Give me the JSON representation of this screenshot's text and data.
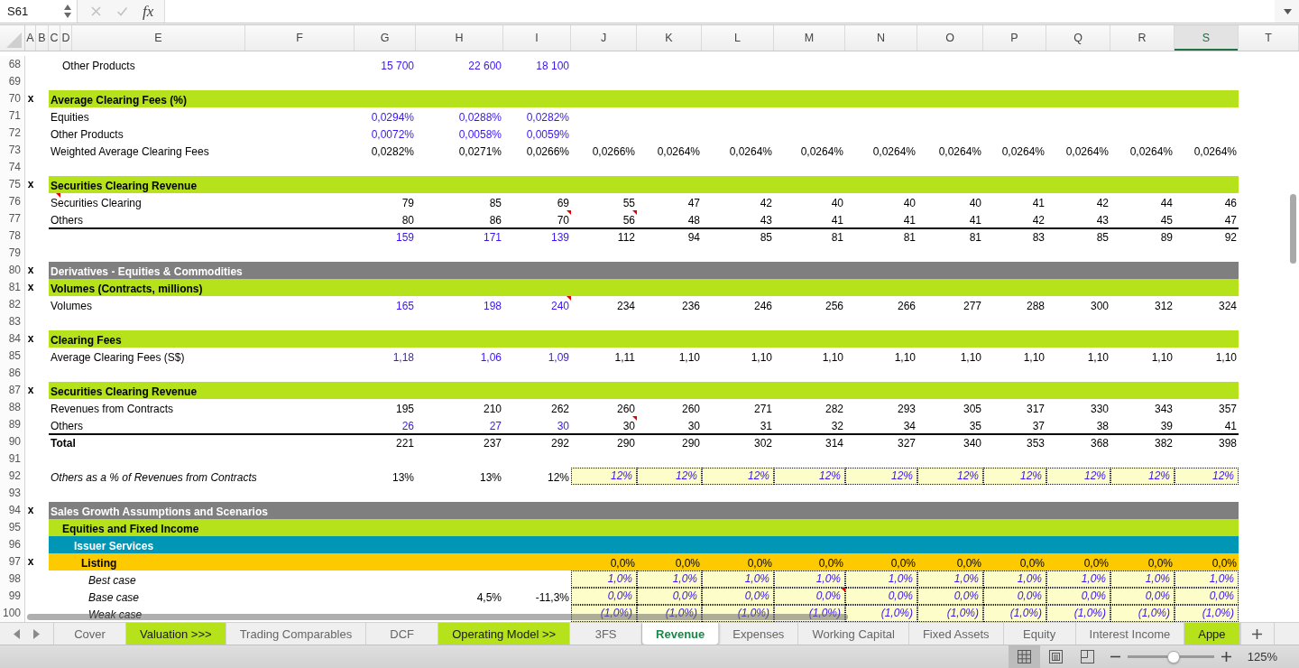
{
  "formula_bar": {
    "name_box": "S61",
    "buttons": [
      {
        "kind": "cancel",
        "disabled": true
      },
      {
        "kind": "confirm",
        "disabled": true
      }
    ],
    "function_label": "fx"
  },
  "columns": [
    {
      "label": "A",
      "selected": false
    },
    {
      "label": "B",
      "selected": false
    },
    {
      "label": "C",
      "selected": false
    },
    {
      "label": "D",
      "selected": false
    },
    {
      "label": "E",
      "selected": false
    },
    {
      "label": "F",
      "selected": false
    },
    {
      "label": "G",
      "selected": false
    },
    {
      "label": "H",
      "selected": false
    },
    {
      "label": "I",
      "selected": false
    },
    {
      "label": "J",
      "selected": false
    },
    {
      "label": "K",
      "selected": false
    },
    {
      "label": "L",
      "selected": false
    },
    {
      "label": "M",
      "selected": false
    },
    {
      "label": "N",
      "selected": false
    },
    {
      "label": "O",
      "selected": false
    },
    {
      "label": "P",
      "selected": false
    },
    {
      "label": "Q",
      "selected": false
    },
    {
      "label": "R",
      "selected": false
    },
    {
      "label": "S",
      "selected": true
    },
    {
      "label": "T",
      "selected": false
    }
  ],
  "rows": [
    {
      "number": "68",
      "kind": "data",
      "cells": [
        null,
        {
          "text": "Other Products",
          "kind": "label",
          "bold": false,
          "italic": false,
          "comment": false
        },
        null,
        null,
        {
          "text": "15 700",
          "kind": "input",
          "comment": false
        },
        {
          "text": "22 600",
          "kind": "input",
          "comment": false
        },
        {
          "text": "18 100",
          "kind": "input",
          "comment": false
        }
      ]
    },
    {
      "number": "69",
      "kind": "blank"
    },
    {
      "number": "70",
      "flag": "x",
      "kind": "band",
      "color": "#b5e21a",
      "cells": [
        {
          "text": "Average Clearing Fees (%)",
          "kind": "label",
          "bold": true,
          "italic": false,
          "comment": false
        }
      ]
    },
    {
      "number": "71",
      "kind": "data",
      "cells": [
        {
          "text": "Equities",
          "kind": "label",
          "bold": false,
          "italic": false,
          "comment": false
        },
        null,
        null,
        null,
        {
          "text": "0,0294%",
          "kind": "input",
          "comment": false
        },
        {
          "text": "0,0288%",
          "kind": "input",
          "comment": false
        },
        {
          "text": "0,0282%",
          "kind": "input",
          "comment": false
        }
      ]
    },
    {
      "number": "72",
      "kind": "data",
      "cells": [
        {
          "text": "Other Products",
          "kind": "label",
          "bold": false,
          "italic": false,
          "comment": false
        },
        null,
        null,
        null,
        {
          "text": "0,0072%",
          "kind": "input",
          "comment": false
        },
        {
          "text": "0,0058%",
          "kind": "input",
          "comment": false
        },
        {
          "text": "0,0059%",
          "kind": "input",
          "comment": false
        }
      ]
    },
    {
      "number": "73",
      "kind": "data",
      "cells": [
        {
          "text": "Weighted Average Clearing Fees",
          "kind": "label",
          "bold": false,
          "italic": false,
          "comment": false
        },
        null,
        null,
        null,
        {
          "text": "0,0282%",
          "kind": "formula",
          "comment": false
        },
        {
          "text": "0,0271%",
          "kind": "formula",
          "comment": false
        },
        {
          "text": "0,0266%",
          "kind": "formula",
          "comment": false
        },
        {
          "text": "0,0266%",
          "kind": "formula",
          "comment": false
        },
        {
          "text": "0,0264%",
          "kind": "formula",
          "comment": false
        },
        {
          "text": "0,0264%",
          "kind": "formula",
          "comment": false
        },
        {
          "text": "0,0264%",
          "kind": "formula",
          "comment": false
        },
        {
          "text": "0,0264%",
          "kind": "formula",
          "comment": false
        },
        {
          "text": "0,0264%",
          "kind": "formula",
          "comment": false
        },
        {
          "text": "0,0264%",
          "kind": "formula",
          "comment": false
        },
        {
          "text": "0,0264%",
          "kind": "formula",
          "comment": false
        },
        {
          "text": "0,0264%",
          "kind": "formula",
          "comment": false
        },
        {
          "text": "0,0264%",
          "kind": "formula",
          "comment": false
        }
      ]
    },
    {
      "number": "74",
      "kind": "blank"
    },
    {
      "number": "75",
      "flag": "x",
      "kind": "band",
      "color": "#b5e21a",
      "cells": [
        {
          "text": "Securities Clearing Revenue",
          "kind": "label",
          "bold": true,
          "italic": false,
          "comment": false
        }
      ]
    },
    {
      "number": "76",
      "kind": "data",
      "cells": [
        {
          "text": "Securities Clearing",
          "kind": "label",
          "bold": false,
          "italic": false,
          "comment": true
        },
        null,
        null,
        null,
        {
          "text": "79",
          "kind": "formula",
          "comment": false
        },
        {
          "text": "85",
          "kind": "formula",
          "comment": false
        },
        {
          "text": "69",
          "kind": "formula",
          "comment": false
        },
        {
          "text": "55",
          "kind": "formula",
          "comment": false
        },
        {
          "text": "47",
          "kind": "formula",
          "comment": false
        },
        {
          "text": "42",
          "kind": "formula",
          "comment": false
        },
        {
          "text": "40",
          "kind": "formula",
          "comment": false
        },
        {
          "text": "40",
          "kind": "formula",
          "comment": false
        },
        {
          "text": "40",
          "kind": "formula",
          "comment": false
        },
        {
          "text": "41",
          "kind": "formula",
          "comment": false
        },
        {
          "text": "42",
          "kind": "formula",
          "comment": false
        },
        {
          "text": "44",
          "kind": "formula",
          "comment": false
        },
        {
          "text": "46",
          "kind": "formula",
          "comment": false
        }
      ]
    },
    {
      "number": "77",
      "kind": "data",
      "cells": [
        {
          "text": "Others",
          "kind": "label",
          "bold": false,
          "italic": false,
          "comment": false
        },
        null,
        null,
        null,
        {
          "text": "80",
          "kind": "formula",
          "comment": false
        },
        {
          "text": "86",
          "kind": "formula",
          "comment": false
        },
        {
          "text": "70",
          "kind": "formula",
          "comment": true
        },
        {
          "text": "56",
          "kind": "formula",
          "comment": true
        },
        {
          "text": "48",
          "kind": "formula",
          "comment": false
        },
        {
          "text": "43",
          "kind": "formula",
          "comment": false
        },
        {
          "text": "41",
          "kind": "formula",
          "comment": false
        },
        {
          "text": "41",
          "kind": "formula",
          "comment": false
        },
        {
          "text": "41",
          "kind": "formula",
          "comment": false
        },
        {
          "text": "42",
          "kind": "formula",
          "comment": false
        },
        {
          "text": "43",
          "kind": "formula",
          "comment": false
        },
        {
          "text": "45",
          "kind": "formula",
          "comment": false
        },
        {
          "text": "47",
          "kind": "formula",
          "comment": false
        }
      ]
    },
    {
      "number": "78",
      "kind": "total",
      "cells": [
        null,
        null,
        null,
        null,
        {
          "text": "159",
          "kind": "input",
          "comment": false
        },
        {
          "text": "171",
          "kind": "input",
          "comment": false
        },
        {
          "text": "139",
          "kind": "input",
          "comment": false
        },
        {
          "text": "112",
          "kind": "formula",
          "comment": false
        },
        {
          "text": "94",
          "kind": "formula",
          "comment": false
        },
        {
          "text": "85",
          "kind": "formula",
          "comment": false
        },
        {
          "text": "81",
          "kind": "formula",
          "comment": false
        },
        {
          "text": "81",
          "kind": "formula",
          "comment": false
        },
        {
          "text": "81",
          "kind": "formula",
          "comment": false
        },
        {
          "text": "83",
          "kind": "formula",
          "comment": false
        },
        {
          "text": "85",
          "kind": "formula",
          "comment": false
        },
        {
          "text": "89",
          "kind": "formula",
          "comment": false
        },
        {
          "text": "92",
          "kind": "formula",
          "comment": false
        }
      ]
    },
    {
      "number": "79",
      "kind": "blank"
    },
    {
      "number": "80",
      "flag": "x",
      "kind": "band",
      "color": "#7f7f7f",
      "cells": [
        {
          "text": "Derivatives - Equities & Commodities",
          "kind": "label",
          "bold": true,
          "italic": false,
          "comment": false
        }
      ]
    },
    {
      "number": "81",
      "flag": "x",
      "kind": "band",
      "color": "#b5e21a",
      "cells": [
        {
          "text": "Volumes (Contracts, millions)",
          "kind": "label",
          "bold": true,
          "italic": false,
          "comment": false
        }
      ]
    },
    {
      "number": "82",
      "kind": "data",
      "cells": [
        {
          "text": "Volumes",
          "kind": "label",
          "bold": false,
          "italic": false,
          "comment": false
        },
        null,
        null,
        null,
        {
          "text": "165",
          "kind": "input",
          "comment": false
        },
        {
          "text": "198",
          "kind": "input",
          "comment": false
        },
        {
          "text": "240",
          "kind": "input",
          "comment": true
        },
        {
          "text": "234",
          "kind": "formula",
          "comment": false
        },
        {
          "text": "236",
          "kind": "formula",
          "comment": false
        },
        {
          "text": "246",
          "kind": "formula",
          "comment": false
        },
        {
          "text": "256",
          "kind": "formula",
          "comment": false
        },
        {
          "text": "266",
          "kind": "formula",
          "comment": false
        },
        {
          "text": "277",
          "kind": "formula",
          "comment": false
        },
        {
          "text": "288",
          "kind": "formula",
          "comment": false
        },
        {
          "text": "300",
          "kind": "formula",
          "comment": false
        },
        {
          "text": "312",
          "kind": "formula",
          "comment": false
        },
        {
          "text": "324",
          "kind": "formula",
          "comment": false
        }
      ]
    },
    {
      "number": "83",
      "kind": "blank"
    },
    {
      "number": "84",
      "flag": "x",
      "kind": "band",
      "color": "#b5e21a",
      "cells": [
        {
          "text": "Clearing Fees",
          "kind": "label",
          "bold": true,
          "italic": false,
          "comment": false
        }
      ]
    },
    {
      "number": "85",
      "kind": "data",
      "cells": [
        {
          "text": "Average Clearing Fees (S$)",
          "kind": "label",
          "bold": false,
          "italic": false,
          "comment": false
        },
        null,
        null,
        null,
        {
          "text": "1,18",
          "kind": "input",
          "comment": false
        },
        {
          "text": "1,06",
          "kind": "input",
          "comment": false
        },
        {
          "text": "1,09",
          "kind": "input",
          "comment": false
        },
        {
          "text": "1,11",
          "kind": "formula",
          "comment": false
        },
        {
          "text": "1,10",
          "kind": "formula",
          "comment": false
        },
        {
          "text": "1,10",
          "kind": "formula",
          "comment": false
        },
        {
          "text": "1,10",
          "kind": "formula",
          "comment": false
        },
        {
          "text": "1,10",
          "kind": "formula",
          "comment": false
        },
        {
          "text": "1,10",
          "kind": "formula",
          "comment": false
        },
        {
          "text": "1,10",
          "kind": "formula",
          "comment": false
        },
        {
          "text": "1,10",
          "kind": "formula",
          "comment": false
        },
        {
          "text": "1,10",
          "kind": "formula",
          "comment": false
        },
        {
          "text": "1,10",
          "kind": "formula",
          "comment": false
        }
      ]
    },
    {
      "number": "86",
      "kind": "blank"
    },
    {
      "number": "87",
      "flag": "x",
      "kind": "band",
      "color": "#b5e21a",
      "cells": [
        {
          "text": "Securities Clearing Revenue",
          "kind": "label",
          "bold": true,
          "italic": false,
          "comment": false
        }
      ]
    },
    {
      "number": "88",
      "kind": "data",
      "cells": [
        {
          "text": "Revenues from Contracts",
          "kind": "label",
          "bold": false,
          "italic": false,
          "comment": false
        },
        null,
        null,
        null,
        {
          "text": "195",
          "kind": "formula",
          "comment": false
        },
        {
          "text": "210",
          "kind": "formula",
          "comment": false
        },
        {
          "text": "262",
          "kind": "formula",
          "comment": false
        },
        {
          "text": "260",
          "kind": "formula",
          "comment": false
        },
        {
          "text": "260",
          "kind": "formula",
          "comment": false
        },
        {
          "text": "271",
          "kind": "formula",
          "comment": false
        },
        {
          "text": "282",
          "kind": "formula",
          "comment": false
        },
        {
          "text": "293",
          "kind": "formula",
          "comment": false
        },
        {
          "text": "305",
          "kind": "formula",
          "comment": false
        },
        {
          "text": "317",
          "kind": "formula",
          "comment": false
        },
        {
          "text": "330",
          "kind": "formula",
          "comment": false
        },
        {
          "text": "343",
          "kind": "formula",
          "comment": false
        },
        {
          "text": "357",
          "kind": "formula",
          "comment": false
        }
      ]
    },
    {
      "number": "89",
      "kind": "data",
      "cells": [
        {
          "text": "Others",
          "kind": "label",
          "bold": false,
          "italic": false,
          "comment": false
        },
        null,
        null,
        null,
        {
          "text": "26",
          "kind": "input",
          "comment": false
        },
        {
          "text": "27",
          "kind": "input",
          "comment": false
        },
        {
          "text": "30",
          "kind": "input",
          "comment": false
        },
        {
          "text": "30",
          "kind": "formula",
          "comment": true
        },
        {
          "text": "30",
          "kind": "formula",
          "comment": false
        },
        {
          "text": "31",
          "kind": "formula",
          "comment": false
        },
        {
          "text": "32",
          "kind": "formula",
          "comment": false
        },
        {
          "text": "34",
          "kind": "formula",
          "comment": false
        },
        {
          "text": "35",
          "kind": "formula",
          "comment": false
        },
        {
          "text": "37",
          "kind": "formula",
          "comment": false
        },
        {
          "text": "38",
          "kind": "formula",
          "comment": false
        },
        {
          "text": "39",
          "kind": "formula",
          "comment": false
        },
        {
          "text": "41",
          "kind": "formula",
          "comment": false
        }
      ]
    },
    {
      "number": "90",
      "kind": "total",
      "cells": [
        {
          "text": "Total",
          "kind": "label",
          "bold": true,
          "italic": false,
          "comment": false
        },
        null,
        null,
        null,
        {
          "text": "221",
          "kind": "formula",
          "comment": false
        },
        {
          "text": "237",
          "kind": "formula",
          "comment": false
        },
        {
          "text": "292",
          "kind": "formula",
          "comment": false
        },
        {
          "text": "290",
          "kind": "formula",
          "comment": false
        },
        {
          "text": "290",
          "kind": "formula",
          "comment": false
        },
        {
          "text": "302",
          "kind": "formula",
          "comment": false
        },
        {
          "text": "314",
          "kind": "formula",
          "comment": false
        },
        {
          "text": "327",
          "kind": "formula",
          "comment": false
        },
        {
          "text": "340",
          "kind": "formula",
          "comment": false
        },
        {
          "text": "353",
          "kind": "formula",
          "comment": false
        },
        {
          "text": "368",
          "kind": "formula",
          "comment": false
        },
        {
          "text": "382",
          "kind": "formula",
          "comment": false
        },
        {
          "text": "398",
          "kind": "formula",
          "comment": false
        }
      ]
    },
    {
      "number": "91",
      "kind": "blank"
    },
    {
      "number": "92",
      "kind": "data",
      "cells": [
        {
          "text": "Others as a % of Revenues from Contracts",
          "kind": "label",
          "bold": false,
          "italic": true,
          "comment": false
        },
        null,
        null,
        null,
        {
          "text": "13%",
          "kind": "formula",
          "comment": false
        },
        {
          "text": "13%",
          "kind": "formula",
          "comment": false
        },
        {
          "text": "12%",
          "kind": "formula",
          "comment": false
        },
        {
          "text": "12%",
          "kind": "assumption",
          "comment": false
        },
        {
          "text": "12%",
          "kind": "assumption",
          "comment": false
        },
        {
          "text": "12%",
          "kind": "assumption",
          "comment": false
        },
        {
          "text": "12%",
          "kind": "assumption",
          "comment": false
        },
        {
          "text": "12%",
          "kind": "assumption",
          "comment": false
        },
        {
          "text": "12%",
          "kind": "assumption",
          "comment": false
        },
        {
          "text": "12%",
          "kind": "assumption",
          "comment": false
        },
        {
          "text": "12%",
          "kind": "assumption",
          "comment": false
        },
        {
          "text": "12%",
          "kind": "assumption",
          "comment": false
        },
        {
          "text": "12%",
          "kind": "assumption",
          "comment": false
        }
      ]
    },
    {
      "number": "93",
      "kind": "blank"
    },
    {
      "number": "94",
      "flag": "x",
      "kind": "band",
      "color": "#7f7f7f",
      "cells": [
        {
          "text": "Sales Growth Assumptions and Scenarios",
          "kind": "label",
          "bold": true,
          "italic": false,
          "comment": false
        }
      ]
    },
    {
      "number": "95",
      "kind": "band",
      "color": "#b5e21a",
      "cells": [
        null,
        {
          "text": "Equities and Fixed Income",
          "kind": "label",
          "bold": true,
          "italic": false,
          "comment": false
        }
      ]
    },
    {
      "number": "96",
      "kind": "band",
      "color": "#0097b7",
      "cells": [
        null,
        null,
        {
          "text": "Issuer Services",
          "kind": "label",
          "bold": true,
          "italic": false,
          "comment": false
        }
      ],
      "children": [
        {
          "number": "97",
          "flag": "x",
          "kind": "band",
          "color": "#fdca00",
          "cells": [
            null,
            null,
            {
              "text": "Listing",
              "kind": "label",
              "bold": true,
              "italic": false,
              "comment": false
            },
            null,
            null,
            null,
            null,
            {
              "text": "0,0%",
              "kind": "formula",
              "comment": false
            },
            {
              "text": "0,0%",
              "kind": "formula",
              "comment": false
            },
            {
              "text": "0,0%",
              "kind": "formula",
              "comment": false
            },
            {
              "text": "0,0%",
              "kind": "formula",
              "comment": false
            },
            {
              "text": "0,0%",
              "kind": "formula",
              "comment": false
            },
            {
              "text": "0,0%",
              "kind": "formula",
              "comment": false
            },
            {
              "text": "0,0%",
              "kind": "formula",
              "comment": false
            },
            {
              "text": "0,0%",
              "kind": "formula",
              "comment": false
            },
            {
              "text": "0,0%",
              "kind": "formula",
              "comment": false
            },
            {
              "text": "0,0%",
              "kind": "formula",
              "comment": false
            }
          ],
          "children": [
            {
              "number": "98",
              "kind": "data",
              "cells": [
                null,
                null,
                {
                  "text": "Best case",
                  "kind": "label",
                  "bold": false,
                  "italic": true,
                  "comment": false
                },
                null,
                null,
                null,
                null,
                {
                  "text": "1,0%",
                  "kind": "assumption",
                  "comment": false
                },
                {
                  "text": "1,0%",
                  "kind": "assumption",
                  "comment": false
                },
                {
                  "text": "1,0%",
                  "kind": "assumption",
                  "comment": false
                },
                {
                  "text": "1,0%",
                  "kind": "assumption",
                  "comment": false
                },
                {
                  "text": "1,0%",
                  "kind": "assumption",
                  "comment": false
                },
                {
                  "text": "1,0%",
                  "kind": "assumption",
                  "comment": false
                },
                {
                  "text": "1,0%",
                  "kind": "assumption",
                  "comment": false
                },
                {
                  "text": "1,0%",
                  "kind": "assumption",
                  "comment": false
                },
                {
                  "text": "1,0%",
                  "kind": "assumption",
                  "comment": false
                },
                {
                  "text": "1,0%",
                  "kind": "assumption",
                  "comment": false
                }
              ]
            },
            {
              "number": "99",
              "kind": "data",
              "cells": [
                null,
                null,
                {
                  "text": "Base case",
                  "kind": "label",
                  "bold": false,
                  "italic": true,
                  "comment": false
                },
                null,
                null,
                {
                  "text": "4,5%",
                  "kind": "formula",
                  "comment": false
                },
                {
                  "text": "-11,3%",
                  "kind": "formula",
                  "comment": false
                },
                {
                  "text": "0,0%",
                  "kind": "assumption",
                  "comment": false
                },
                {
                  "text": "0,0%",
                  "kind": "assumption",
                  "comment": false
                },
                {
                  "text": "0,0%",
                  "kind": "assumption",
                  "comment": false
                },
                {
                  "text": "0,0%",
                  "kind": "assumption",
                  "comment": true
                },
                {
                  "text": "0,0%",
                  "kind": "assumption",
                  "comment": false
                },
                {
                  "text": "0,0%",
                  "kind": "assumption",
                  "comment": false
                },
                {
                  "text": "0,0%",
                  "kind": "assumption",
                  "comment": false
                },
                {
                  "text": "0,0%",
                  "kind": "assumption",
                  "comment": false
                },
                {
                  "text": "0,0%",
                  "kind": "assumption",
                  "comment": false
                },
                {
                  "text": "0,0%",
                  "kind": "assumption",
                  "comment": false
                }
              ]
            },
            {
              "number": "100",
              "kind": "data",
              "cells": [
                null,
                null,
                {
                  "text": "Weak case",
                  "kind": "label",
                  "bold": false,
                  "italic": true,
                  "comment": false
                },
                null,
                null,
                null,
                null,
                {
                  "text": "(1,0%)",
                  "kind": "assumption",
                  "comment": false
                },
                {
                  "text": "(1,0%)",
                  "kind": "assumption",
                  "comment": false
                },
                {
                  "text": "(1,0%)",
                  "kind": "assumption",
                  "comment": false
                },
                {
                  "text": "(1,0%)",
                  "kind": "assumption",
                  "comment": false
                },
                {
                  "text": "(1,0%)",
                  "kind": "assumption",
                  "comment": false
                },
                {
                  "text": "(1,0%)",
                  "kind": "assumption",
                  "comment": false
                },
                {
                  "text": "(1,0%)",
                  "kind": "assumption",
                  "comment": false
                },
                {
                  "text": "(1,0%)",
                  "kind": "assumption",
                  "comment": false
                },
                {
                  "text": "(1,0%)",
                  "kind": "assumption",
                  "comment": false
                },
                {
                  "text": "(1,0%)",
                  "kind": "assumption",
                  "comment": false
                }
              ]
            }
          ]
        }
      ]
    }
  ],
  "sheet_tabs": [
    {
      "label": "Cover",
      "selected": false
    },
    {
      "label": "Valuation >>>",
      "selected": false,
      "color": "#b5e21a"
    },
    {
      "label": "Trading Comparables",
      "selected": false
    },
    {
      "label": "DCF",
      "selected": false
    },
    {
      "label": "Operating Model >>",
      "selected": false,
      "color": "#b5e21a"
    },
    {
      "label": "3FS",
      "selected": false
    },
    {
      "label": "Revenue",
      "selected": true
    },
    {
      "label": "Expenses",
      "selected": false
    },
    {
      "label": "Working Capital",
      "selected": false
    },
    {
      "label": "Fixed Assets",
      "selected": false
    },
    {
      "label": "Equity",
      "selected": false
    },
    {
      "label": "Interest Income",
      "selected": false
    },
    {
      "label": "Appe",
      "selected": false,
      "color": "#b5e21a"
    }
  ],
  "status_bar": {
    "views": [
      {
        "kind": "normal",
        "selected": true
      },
      {
        "kind": "page_layout",
        "selected": false
      },
      {
        "kind": "page_break",
        "selected": false
      }
    ],
    "zoom": {
      "level": 0.53,
      "reading": "125%"
    }
  }
}
